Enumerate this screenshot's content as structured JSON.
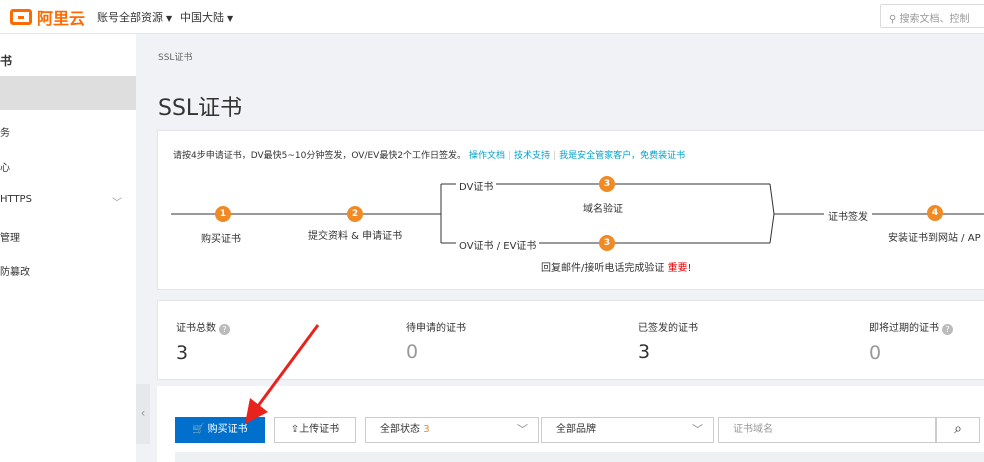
{
  "topbar": {
    "logo_text": "阿里云",
    "account_resources": "账号全部资源",
    "region": "中国大陆",
    "search_placeholder": "搜索文档、控制"
  },
  "sidebar": {
    "title": "书",
    "items": [
      {
        "label": "",
        "active": true
      },
      {
        "label": "务"
      },
      {
        "label": "心"
      },
      {
        "label": "HTTPS",
        "has_chevron": true
      },
      {
        "label": "管理"
      },
      {
        "label": "防篡改"
      }
    ],
    "collapse_glyph": "‹"
  },
  "breadcrumb": "SSL证书",
  "page_title": "SSL证书",
  "guide": {
    "intro": "请按4步申请证书，DV最快5~10分钟签发，OV/EV最快2个工作日签发。",
    "links": [
      "操作文档",
      "技术支持",
      "我是安全管家客户，免费装证书"
    ],
    "steps": {
      "s1_num": "1",
      "s1_label": "购买证书",
      "s2_num": "2",
      "s2_label": "提交资料 & 申请证书",
      "dv_label": "DV证书",
      "dv_num": "3",
      "dv_desc": "域名验证",
      "ov_label": "OV证书 / EV证书",
      "ov_num": "3",
      "ov_desc": "回复邮件/接听电话完成验证",
      "ov_important": "重要!",
      "sign_label": "证书签发",
      "s4_num": "4",
      "s4_label": "安装证书到网站 / AP"
    }
  },
  "stats": [
    {
      "label": "证书总数",
      "value": "3",
      "help": true
    },
    {
      "label": "待申请的证书",
      "value": "0",
      "muted": true
    },
    {
      "label": "已签发的证书",
      "value": "3"
    },
    {
      "label": "即将过期的证书",
      "value": "0",
      "help": true,
      "muted": true
    }
  ],
  "toolbar": {
    "buy_label": "购买证书",
    "upload_label": "上传证书",
    "status_select": "全部状态",
    "status_count": "3",
    "brand_select": "全部品牌",
    "domain_placeholder": "证书域名"
  },
  "colors": {
    "brand_orange": "#ff6a00",
    "step_orange": "#f08a24",
    "primary_blue": "#0070cc",
    "link_blue": "#00a2ca",
    "annotation_red": "#e8231e"
  }
}
